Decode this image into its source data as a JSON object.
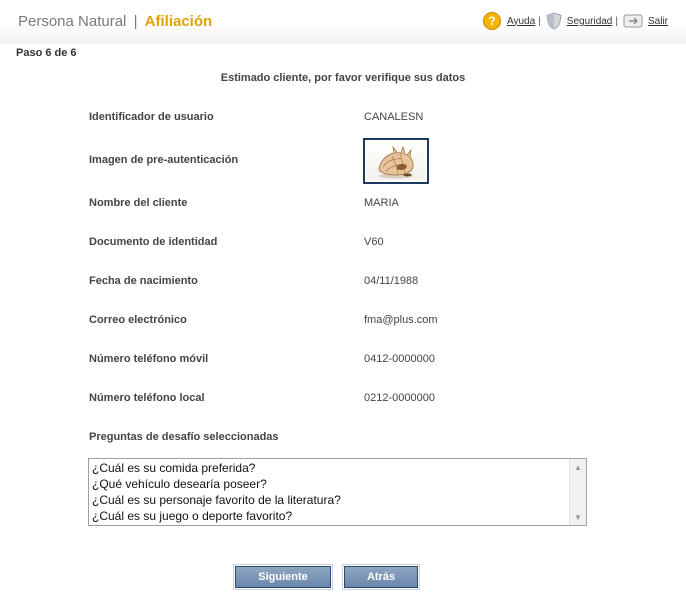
{
  "header": {
    "brand": "Persona Natural",
    "separator": "|",
    "section": "Afiliación",
    "help_label": "Ayuda",
    "security_label": "Seguridad",
    "exit_label": "Salir",
    "link_separator": "|"
  },
  "step_label": "Paso 6 de 6",
  "intro": "Estimado cliente, por favor verifique sus datos",
  "fields": {
    "user_id": {
      "label": "Identificador de usuario",
      "value": "CANALESN"
    },
    "preauth_image": {
      "label": "Imagen de pre-autenticación"
    },
    "name": {
      "label": "Nombre del cliente",
      "value": "MARIA"
    },
    "document": {
      "label": "Documento de identidad",
      "value": "V60"
    },
    "birth_date": {
      "label": "Fecha de nacimiento",
      "value": "04/11/1988"
    },
    "email": {
      "label": "Correo electrónico",
      "value": "fma@plus.com"
    },
    "mobile": {
      "label": "Número teléfono móvil",
      "value": "0412-0000000"
    },
    "landline": {
      "label": "Número teléfono local",
      "value": "0212-0000000"
    }
  },
  "challenge": {
    "label": "Preguntas de desafío seleccionadas",
    "questions": [
      "¿Cuál es su comida preferida?",
      "¿Qué vehículo desearía poseer?",
      "¿Cuál es su personaje favorito de la literatura?",
      "¿Cuál es su juego o deporte favorito?"
    ]
  },
  "buttons": {
    "next": "Siguiente",
    "back": "Atrás"
  },
  "icons": {
    "help": "help-circle-icon",
    "security": "shield-icon",
    "exit": "exit-icon",
    "help_glyph": "?"
  },
  "colors": {
    "accent": "#e0a300",
    "button": "#6b87ab",
    "image_border": "#1f3a60"
  }
}
